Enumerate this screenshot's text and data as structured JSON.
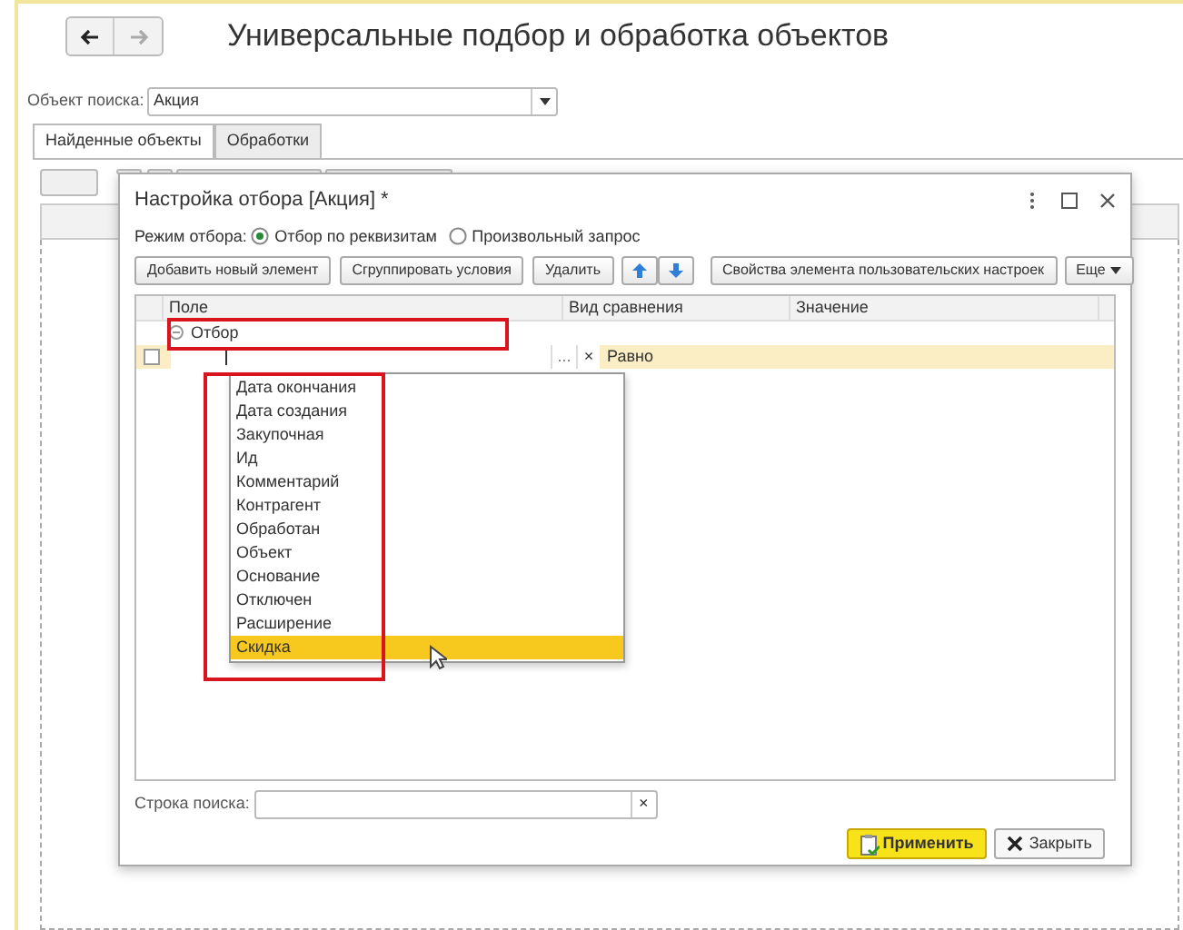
{
  "window": {
    "title": "Универсальные подбор и обработка объектов"
  },
  "search_object": {
    "label": "Объект поиска:",
    "value": "Акция"
  },
  "tabs": [
    {
      "label": "Найденные объекты",
      "selected": true
    },
    {
      "label": "Обработки",
      "selected": false
    }
  ],
  "dialog": {
    "title": "Настройка отбора [Акция] *",
    "mode": {
      "label": "Режим отбора:",
      "options": [
        {
          "label": "Отбор по реквизитам",
          "selected": true
        },
        {
          "label": "Произвольный запрос",
          "selected": false
        }
      ]
    },
    "buttons": [
      "Добавить новый элемент",
      "Сгруппировать условия",
      "Удалить"
    ],
    "props_button": "Свойства элемента пользовательских настроек",
    "more_button": "Еще",
    "columns": [
      "Поле",
      "Вид сравнения",
      "Значение"
    ],
    "group": {
      "label": "Отбор",
      "expanded": true
    },
    "row": {
      "checked": false,
      "comparison": "Равно",
      "clear": "×",
      "more": "..."
    },
    "dropdown": [
      {
        "label": "Дата окончания",
        "selected": false
      },
      {
        "label": "Дата создания",
        "selected": false
      },
      {
        "label": "Закупочная",
        "selected": false
      },
      {
        "label": "Ид",
        "selected": false
      },
      {
        "label": "Комментарий",
        "selected": false
      },
      {
        "label": "Контрагент",
        "selected": false
      },
      {
        "label": "Обработан",
        "selected": false
      },
      {
        "label": "Объект",
        "selected": false
      },
      {
        "label": "Основание",
        "selected": false
      },
      {
        "label": "Отключен",
        "selected": false
      },
      {
        "label": "Расширение",
        "selected": false
      },
      {
        "label": "Скидка",
        "selected": true
      }
    ],
    "search": {
      "label": "Строка поиска:",
      "clear": "×"
    },
    "apply": "Применить",
    "close": "Закрыть"
  }
}
